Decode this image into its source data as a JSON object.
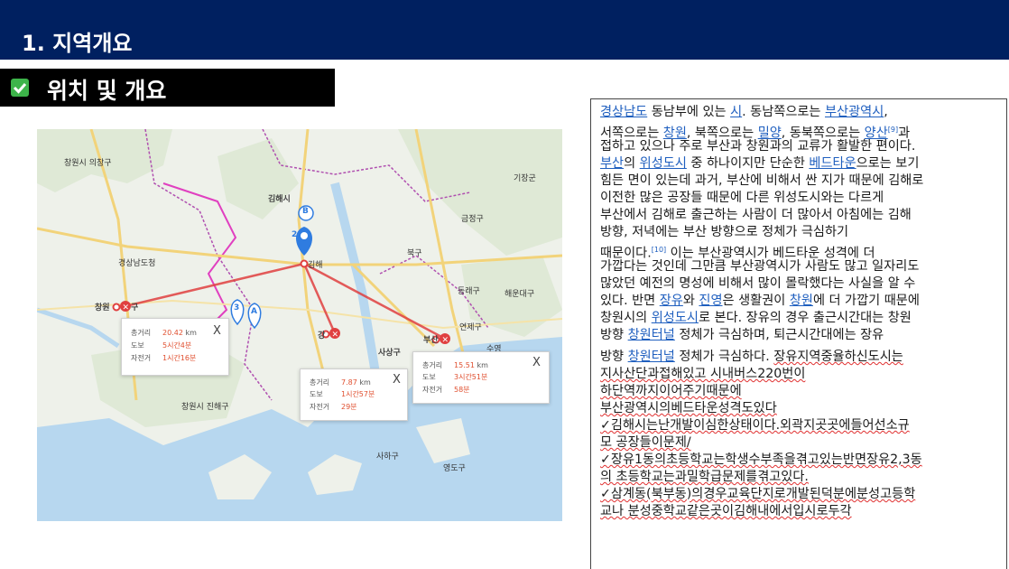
{
  "header": {
    "title": "1. 지역개요"
  },
  "section": {
    "title": "위치 및 개요",
    "check_color": "#3db44a"
  },
  "map": {
    "labels": {
      "changwon_uichang": "창원시 의창구",
      "gijang": "기장군",
      "gimhae": "김해시",
      "geumjeong": "금정구",
      "gyeongnam_office": "경상남도청",
      "changwon": "창원",
      "guseong": "구",
      "gimhae_pin": "김해",
      "buk": "북구",
      "dongrae": "동래구",
      "haeundae": "해운대구",
      "yeonje": "연제구",
      "sasang": "사상구",
      "busan": "부산",
      "gang": "강",
      "suyeong": "수영",
      "jinhae": "창원시 진해구",
      "saha": "사하구",
      "yeongdo": "영도구",
      "pin_b": "B",
      "pin_a": "A",
      "pin_3": "3",
      "pin_2": "2"
    },
    "popups": {
      "changwon": {
        "dist_label": "총거리",
        "dist_value": "20.42",
        "dist_unit": "km",
        "walk_label": "도보",
        "walk_value": "5시간4분",
        "bike_label": "자전거",
        "bike_value": "1시간16분",
        "close": "X"
      },
      "gang": {
        "dist_label": "총거리",
        "dist_value": "7.87",
        "dist_unit": "km",
        "walk_label": "도보",
        "walk_value": "1시간57분",
        "bike_label": "자전거",
        "bike_value": "29분",
        "close": "X"
      },
      "busan": {
        "dist_label": "총거리",
        "dist_value": "15.51",
        "dist_unit": "km",
        "walk_label": "도보",
        "walk_value": "3시간51분",
        "bike_label": "자전거",
        "bike_value": "58분",
        "close": "X"
      }
    }
  },
  "text": {
    "l1": {
      "a": "경상남도",
      "b": " 동남부에 있는 ",
      "c": "시",
      "d": ". 동남쪽으로는 ",
      "e": "부산광역시",
      "f": ","
    },
    "l2": {
      "a": "서쪽으로는 ",
      "b": "창원",
      "c": ", 북쪽으로는 ",
      "d": "밀양",
      "e": ", 동북쪽으로는 ",
      "f": "양산",
      "g": "[9]",
      "h": "과"
    },
    "l3": "접하고 있으나 주로 부산과 창원과의 교류가 활발한 편이다.",
    "l4": {
      "a": "부산",
      "b": "의 ",
      "c": "위성도시",
      "d": " 중 하나이지만 단순한 ",
      "e": "베드타운",
      "f": "으로는 보기"
    },
    "l5": "힘든 면이 있는데 과거, 부산에 비해서 싼 지가 때문에 김해로",
    "l6": "이전한 많은 공장들 때문에 다른 위성도시와는 다르게",
    "l7": "부산에서 김해로 출근하는 사람이 더 많아서 아침에는 김해",
    "l8": "방향, 저녁에는 부산 방향으로 정체가 극심하기",
    "l9": {
      "a": "때문이다.",
      "b": "[10]",
      "c": " 이는 부산광역시가 베드타운 성격에 더"
    },
    "l10": "가깝다는 것인데 그만큼 부산광역시가 사람도 많고 일자리도",
    "l11": "많았던 예전의 명성에 비해서 많이 몰락했다는 사실을 알 수",
    "l12": {
      "a": "있다. 반면 ",
      "b": "장유",
      "c": "와 ",
      "d": "진영",
      "e": "은 생활권이 ",
      "f": "창원",
      "g": "에 더 가깝기 때문에"
    },
    "l13": {
      "a": "창원시의 ",
      "b": "위성도시",
      "c": "로 본다. 장유의 경우 출근시간대는 창원"
    },
    "l14": {
      "a": "방향 ",
      "b": "창원터널",
      "c": " 정체가 극심하며, 퇴근시간대에는 장유"
    },
    "l15": {
      "a": "방향 ",
      "b": "창원터널",
      "c": " 정체가 극심하다. ",
      "d": "장유지역중율하신도시는"
    },
    "l16": "지사산단과접해있고 시내버스220번이",
    "l17": "하단역까지이어주기때문에",
    "l18": "부산광역시의베드타운성격도있다",
    "l19": "✓김해시는난개발이심한상태이다.외곽지곳곳에들어선소규",
    "l20": "모 공장들이문제/",
    "l21": "✓장유1동의초등학교는학생수부족을겪고있는반면장유2,3동",
    "l22": "의 초등학교는과밀학급문제를겪고있다.",
    "l23": "✓삼계동(북부동)의경우교육단지로개발된덕분에분성고등학",
    "l24": "교나 분성중학교같은곳이김해내에서입시로두각"
  }
}
